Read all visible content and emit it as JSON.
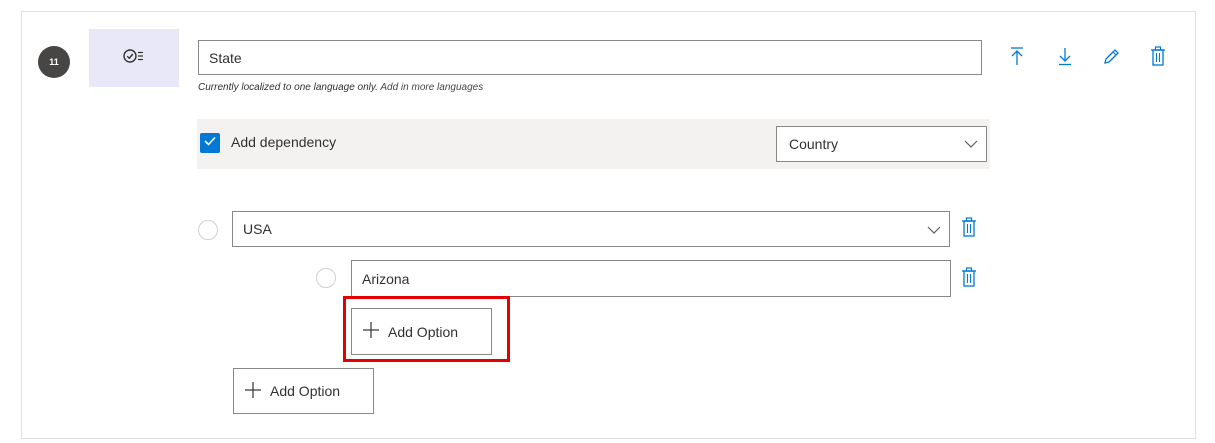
{
  "question": {
    "number": "11",
    "type_icon": "choice-list-icon",
    "title_value": "State",
    "localization_note": "Currently localized to one language only.",
    "localization_link": "Add in more languages"
  },
  "toolbar": {
    "move_top_icon": "move-to-top-icon",
    "move_down_icon": "move-down-icon",
    "edit_icon": "pencil-icon",
    "delete_icon": "trash-icon"
  },
  "dependency": {
    "checked": true,
    "label": "Add dependency",
    "selected_question": "Country"
  },
  "options": [
    {
      "value": "USA",
      "sub_options": [
        {
          "value": "Arizona"
        }
      ],
      "add_sub_option_label": "Add Option"
    }
  ],
  "add_option_label": "Add Option",
  "colors": {
    "accent": "#0078d4",
    "tile_bg": "#e8e8f8",
    "highlight": "#e60000"
  }
}
